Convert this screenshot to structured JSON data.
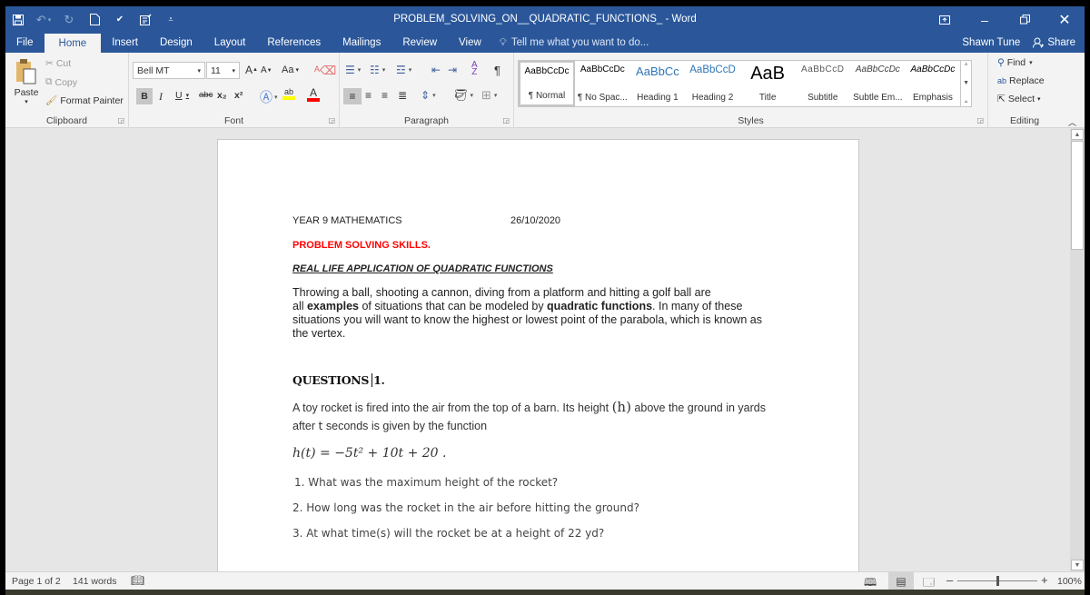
{
  "app": {
    "window_title": "PROBLEM_SOLVING_ON__QUADRATIC_FUNCTIONS_ - Word",
    "user_name": "Shawn Tune",
    "share_label": "Share",
    "tell_me_placeholder": "Tell me what you want to do..."
  },
  "quick_access": [
    "save-icon",
    "undo-icon",
    "redo-icon",
    "new-document-icon",
    "spelling-icon",
    "form-icon",
    "customize-icon"
  ],
  "tabs": [
    {
      "label": "File"
    },
    {
      "label": "Home",
      "active": true
    },
    {
      "label": "Insert"
    },
    {
      "label": "Design"
    },
    {
      "label": "Layout"
    },
    {
      "label": "References"
    },
    {
      "label": "Mailings"
    },
    {
      "label": "Review"
    },
    {
      "label": "View"
    }
  ],
  "ribbon": {
    "clipboard": {
      "label": "Clipboard",
      "paste": "Paste",
      "cut": "Cut",
      "copy": "Copy",
      "format_painter": "Format Painter"
    },
    "font": {
      "label": "Font",
      "font_name": "Bell MT",
      "font_size": "11",
      "change_case": "Aa",
      "bold": "B",
      "italic": "I",
      "underline": "U",
      "strike": "abc",
      "subscript": "x₂",
      "superscript": "x²"
    },
    "paragraph": {
      "label": "Paragraph"
    },
    "styles": {
      "label": "Styles",
      "items": [
        {
          "preview": "AaBbCcDc",
          "name": "¶ Normal",
          "selected": true
        },
        {
          "preview": "AaBbCcDc",
          "name": "¶ No Spac..."
        },
        {
          "preview": "AaBbCc",
          "name": "Heading 1"
        },
        {
          "preview": "AaBbCcD",
          "name": "Heading 2"
        },
        {
          "preview": "AaB",
          "name": "Title"
        },
        {
          "preview": "AaBbCcD",
          "name": "Subtitle"
        },
        {
          "preview": "AaBbCcDc",
          "name": "Subtle Em..."
        },
        {
          "preview": "AaBbCcDc",
          "name": "Emphasis"
        }
      ]
    },
    "editing": {
      "label": "Editing",
      "find": "Find",
      "replace": "Replace",
      "select": "Select"
    }
  },
  "document": {
    "header_left": "YEAR 9 MATHEMATICS",
    "header_date": "26/10/2020",
    "red_heading": "PROBLEM SOLVING SKILLS.",
    "sub_heading": "REAL LIFE APPLICATION OF QUADRATIC FUNCTIONS",
    "intro_lines": [
      [
        "Throwing a ball, shooting a cannon, diving from a platform and hitting a golf ball are"
      ],
      [
        "all ",
        "examples",
        " of situations that can be modeled by ",
        "quadratic functions",
        ". In many of these"
      ],
      [
        "situations you will want to know the highest or lowest point of the parabola, which is known as"
      ],
      [
        "the vertex."
      ]
    ],
    "questions_heading": "QUESTIONS",
    "questions_number": "1.",
    "problem_line1": [
      "A toy rocket is fired into the air from the top of a barn. Its height ",
      "(h)",
      " above the ground in yards"
    ],
    "problem_line2": [
      "after ",
      "t",
      " seconds is given by the function"
    ],
    "equation": "h(t) = −5t² + 10t + 20 .",
    "questions": [
      "1. What was the maximum height of the rocket?",
      "2. How long was the rocket in the air before hitting the ground?",
      "3. At what time(s) will the rocket be at a height of 22 yd?"
    ]
  },
  "status": {
    "page": "Page 1 of 2",
    "words": "141 words",
    "zoom": "100%",
    "zoom_fraction": 0.5
  },
  "colors": {
    "brand": "#2b579a",
    "heading_red": "#ff0000"
  }
}
